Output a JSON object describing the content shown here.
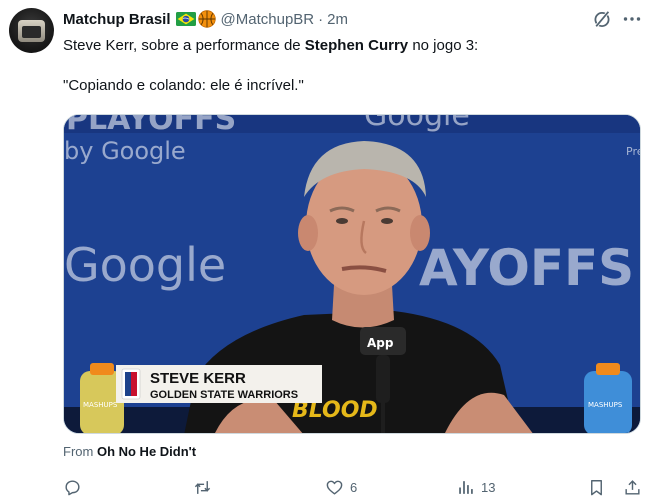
{
  "tweet": {
    "author_name": "Matchup Brasil",
    "author_badges": [
      "brazil-flag-icon",
      "basketball-icon"
    ],
    "handle": "@MatchupBR",
    "separator": "·",
    "time": "2m",
    "text_line1_prefix": "Steve Kerr, sobre a performance de ",
    "text_line1_bold": "Stephen Curry",
    "text_line1_suffix": " no jogo 3:",
    "text_line2": "\"Copiando e colando: ele é incrível.\""
  },
  "media": {
    "bg_top_left": "PLAYOFFS",
    "bg_by_google": "by Google",
    "bg_google_center": "Google",
    "bg_google_top": "Google",
    "bg_playoffs_right": "AYOFFS",
    "bg_pre": "Pre",
    "lower_third_name": "STEVE KERR",
    "lower_third_team": "GOLDEN STATE WARRIORS",
    "mic_label": "App",
    "shirt_text": "BLOOD",
    "bottle_label": "MASHUPS"
  },
  "source": {
    "prefix": "From ",
    "name": "Oh No He Didn't"
  },
  "actions": {
    "reply_count": "",
    "retweet_count": "",
    "like_count": "6",
    "views_count": "13"
  },
  "colors": {
    "text_primary": "#0f1419",
    "text_secondary": "#536471",
    "court_blue": "#1e4494"
  }
}
